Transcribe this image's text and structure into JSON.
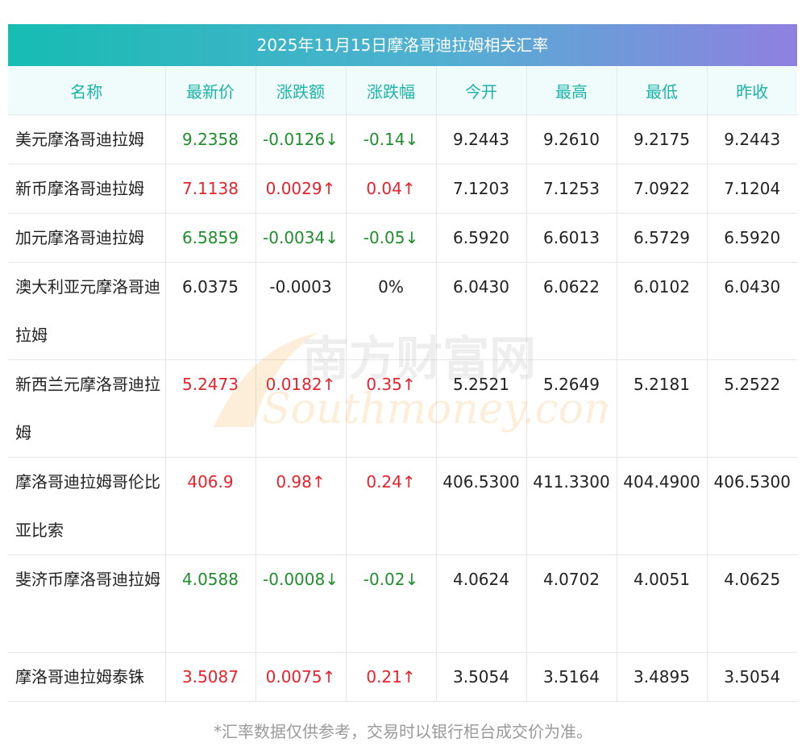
{
  "title": "2025年11月15日摩洛哥迪拉姆相关汇率",
  "headers": [
    "名称",
    "最新价",
    "涨跌额",
    "涨跌幅",
    "今开",
    "最高",
    "最低",
    "昨收"
  ],
  "rows": [
    {
      "name": "美元摩洛哥迪拉姆",
      "latest": "9.2358",
      "change": "-0.0126↓",
      "pct": "-0.14↓",
      "open": "9.2443",
      "high": "9.2610",
      "low": "9.2175",
      "prev": "9.2443",
      "trend": "down"
    },
    {
      "name": "新币摩洛哥迪拉姆",
      "latest": "7.1138",
      "change": "0.0029↑",
      "pct": "0.04↑",
      "open": "7.1203",
      "high": "7.1253",
      "low": "7.0922",
      "prev": "7.1204",
      "trend": "up"
    },
    {
      "name": "加元摩洛哥迪拉姆",
      "latest": "6.5859",
      "change": "-0.0034↓",
      "pct": "-0.05↓",
      "open": "6.5920",
      "high": "6.6013",
      "low": "6.5729",
      "prev": "6.5920",
      "trend": "down"
    },
    {
      "name": "澳大利亚元摩洛哥迪拉姆",
      "latest": "6.0375",
      "change": "-0.0003",
      "pct": "0%",
      "open": "6.0430",
      "high": "6.0622",
      "low": "6.0102",
      "prev": "6.0430",
      "trend": "flat"
    },
    {
      "name": "新西兰元摩洛哥迪拉姆",
      "latest": "5.2473",
      "change": "0.0182↑",
      "pct": "0.35↑",
      "open": "5.2521",
      "high": "5.2649",
      "low": "5.2181",
      "prev": "5.2522",
      "trend": "up"
    },
    {
      "name": "摩洛哥迪拉姆哥伦比亚比索",
      "latest": "406.9",
      "change": "0.98↑",
      "pct": "0.24↑",
      "open": "406.5300",
      "high": "411.3300",
      "low": "404.4900",
      "prev": "406.5300",
      "trend": "up"
    },
    {
      "name": "斐济币摩洛哥迪拉姆",
      "latest": "4.0588",
      "change": "-0.0008↓",
      "pct": "-0.02↓",
      "open": "4.0624",
      "high": "4.0702",
      "low": "4.0051",
      "prev": "4.0625",
      "trend": "down"
    },
    {
      "name": "摩洛哥迪拉姆泰铢",
      "latest": "3.5087",
      "change": "0.0075↑",
      "pct": "0.21↑",
      "open": "3.5054",
      "high": "3.5164",
      "low": "3.4895",
      "prev": "3.5054",
      "trend": "up"
    }
  ],
  "note": "*汇率数据仅供参考，交易时以银行柜台成交价为准。",
  "watermark": {
    "cn": "南方财富网",
    "en": "Southmoney.com"
  },
  "colors": {
    "up": "#e8222d",
    "down": "#1f8e2c",
    "header_text": "#1bb4a8",
    "title_from": "#16bcb2",
    "title_to": "#8f80e0"
  }
}
